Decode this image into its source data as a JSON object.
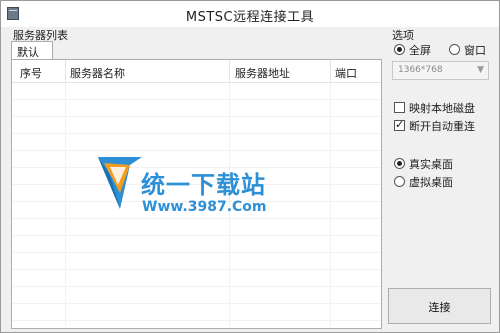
{
  "window": {
    "title": "MSTSC远程连接工具"
  },
  "server_list": {
    "group_label": "服务器列表",
    "tabs": [
      {
        "label": "默认"
      }
    ],
    "columns": [
      "序号",
      "服务器名称",
      "服务器地址",
      "端口"
    ],
    "rows": []
  },
  "watermark": {
    "text_cn": "统一下载站",
    "text_en": "Www.3987.Com"
  },
  "options": {
    "group_label": "选项",
    "fullscreen_label": "全屏",
    "window_label": "窗口",
    "display_mode": "fullscreen",
    "resolution_value": "1366*768",
    "map_local_disk_label": "映射本地磁盘",
    "map_local_disk_checked": false,
    "auto_reconnect_label": "断开自动重连",
    "auto_reconnect_checked": true,
    "real_desktop_label": "真实桌面",
    "virtual_desktop_label": "虚拟桌面",
    "desktop_mode": "real"
  },
  "actions": {
    "connect_label": "连接"
  },
  "colors": {
    "watermark_blue": "#2d8fd6",
    "watermark_orange": "#f39c1e"
  }
}
